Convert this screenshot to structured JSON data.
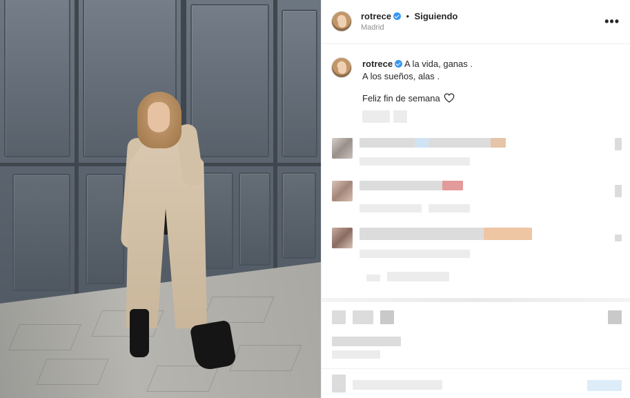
{
  "post": {
    "username": "rotrece",
    "verified": true,
    "separator": "•",
    "follow_status": "Siguiendo",
    "location": "Madrid",
    "more_options_icon": "more-horizontal-icon"
  },
  "caption": {
    "username": "rotrece",
    "line1": "A la vida, ganas .",
    "line2": "A los sueños, alas .",
    "line3": "Feliz fin de semana",
    "trailing_icon": "heart-outline-icon"
  },
  "colors": {
    "verified_badge": "#3897f0",
    "text_primary": "#262626",
    "text_secondary": "#8e8e8e",
    "divider": "#efefef"
  }
}
